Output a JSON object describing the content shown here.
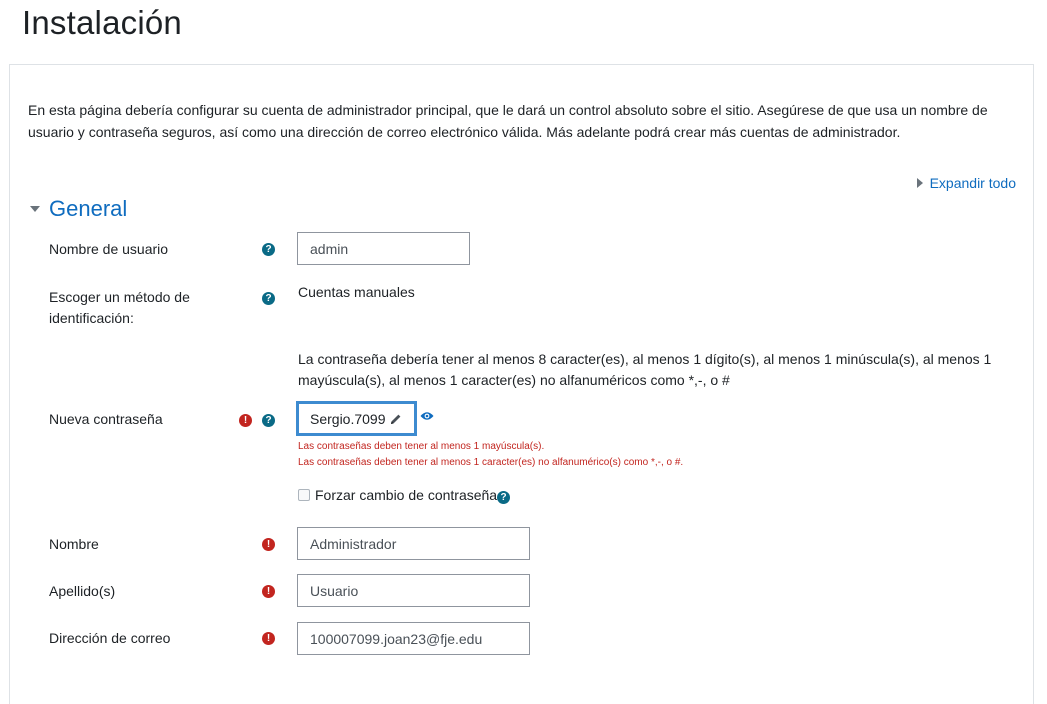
{
  "page": {
    "title": "Instalación"
  },
  "intro": "En esta página debería configurar su cuenta de administrador principal, que le dará un control absoluto sobre el sitio. Asegúrese de que usa un nombre de usuario y contraseña seguros, así como una dirección de correo electrónico válida. Más adelante podrá crear más cuentas de administrador.",
  "expand_all": "Expandir todo",
  "section": {
    "title": "General"
  },
  "fields": {
    "username": {
      "label": "Nombre de usuario",
      "value": "admin"
    },
    "auth": {
      "label": "Escoger un método de identificación:",
      "value": "Cuentas manuales"
    },
    "password": {
      "hint": "La contraseña debería tener al menos 8 caracter(es), al menos 1 dígito(s), al menos 1 minúscula(s), al menos 1 mayúscula(s), al menos 1 caracter(es) no alfanuméricos como *,-, o #",
      "label": "Nueva contraseña",
      "value": "Sergio.7099",
      "errors": [
        "Las contraseñas deben tener al menos 1 mayúscula(s).",
        "Las contraseñas deben tener al menos 1 caracter(es) no alfanumérico(s) como *,-, o #."
      ],
      "force_change_label": "Forzar cambio de contraseña"
    },
    "firstname": {
      "label": "Nombre",
      "value": "Administrador"
    },
    "lastname": {
      "label": "Apellido(s)",
      "value": "Usuario"
    },
    "email": {
      "label": "Dirección de correo",
      "value": "100007099.joan23@fje.edu"
    }
  },
  "icons": {
    "help": "question-circle-icon",
    "required": "exclamation-circle-icon",
    "reveal": "eye-icon",
    "edit": "pencil-icon"
  },
  "colors": {
    "link": "#0f6cbf",
    "help": "#0a6a86",
    "error": "#c2251f",
    "focus": "#3d8bd0"
  }
}
